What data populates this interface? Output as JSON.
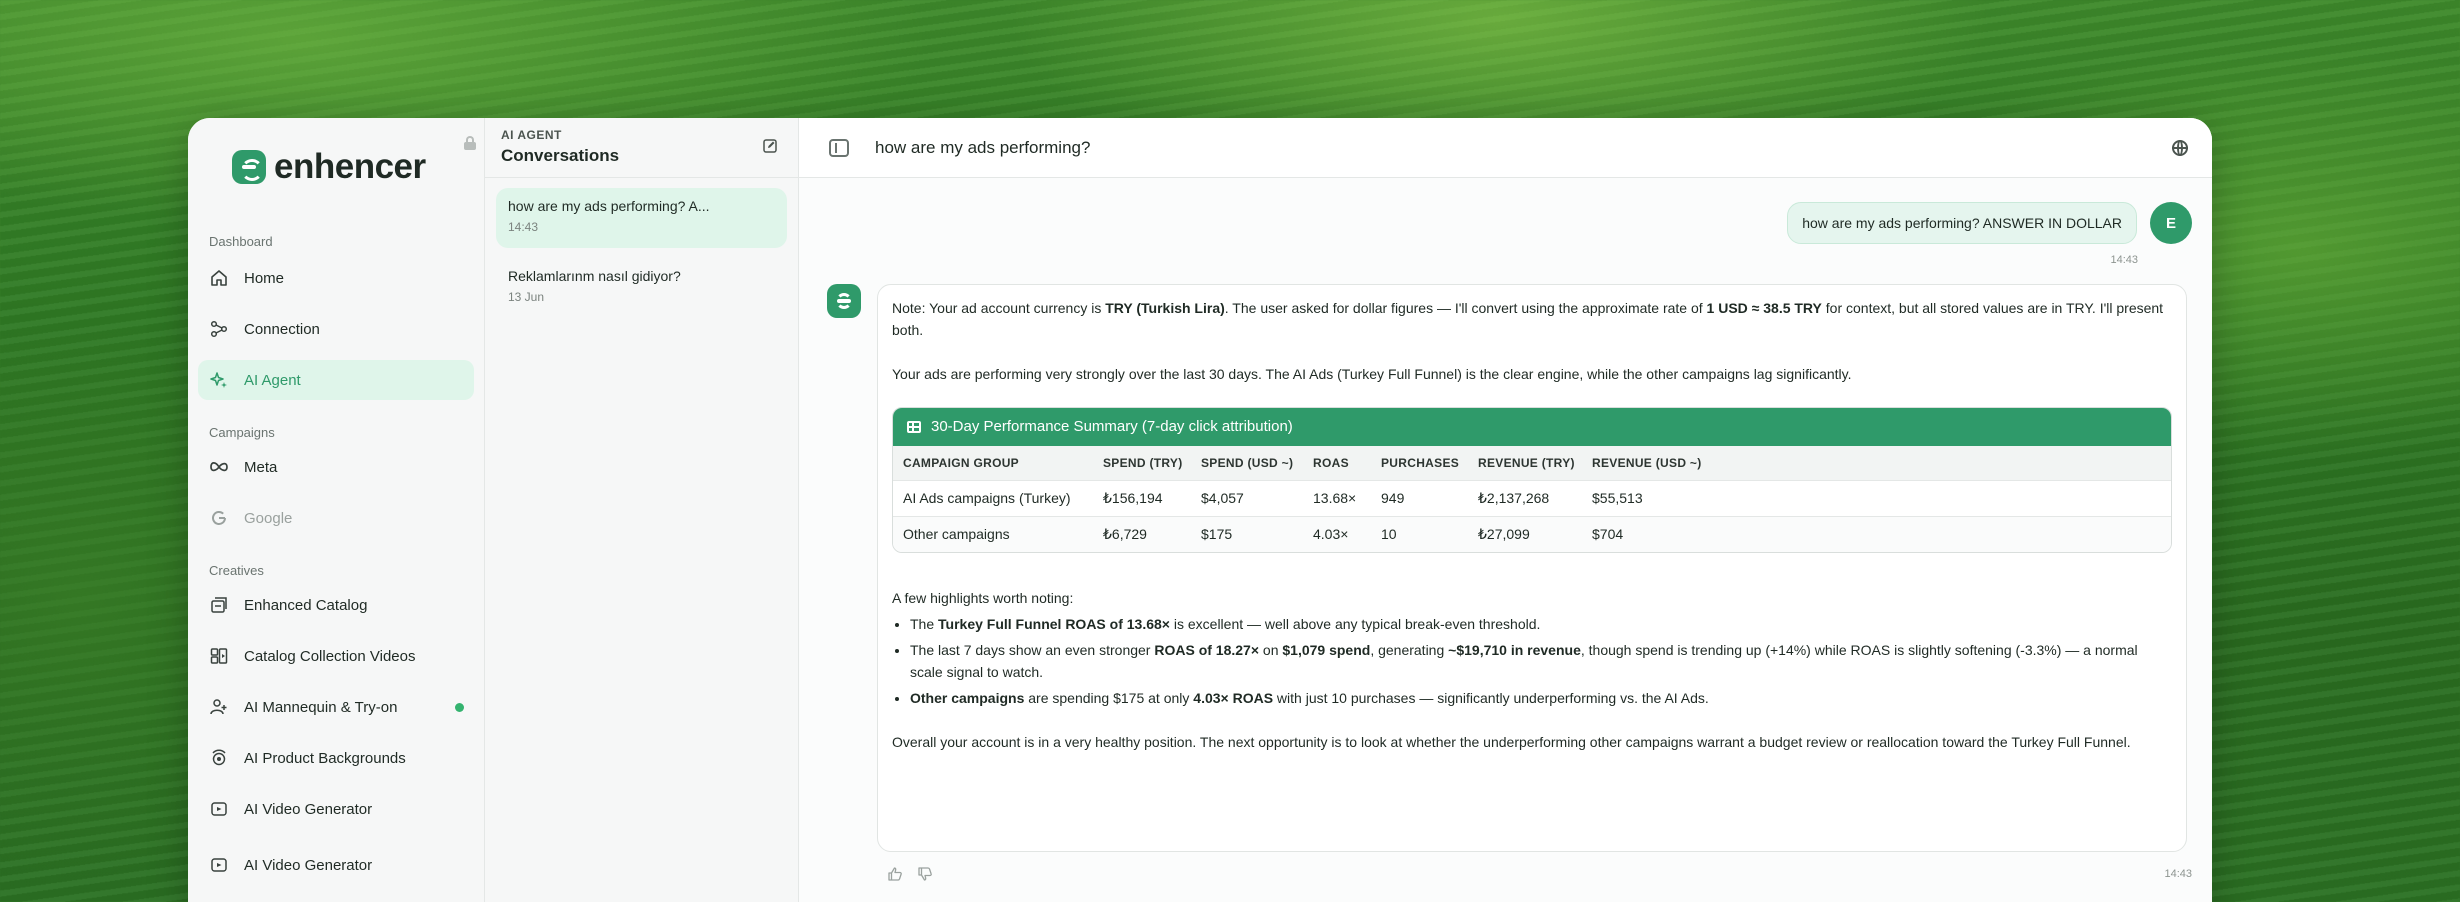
{
  "brand": {
    "name": "enhencer"
  },
  "sidebar": {
    "sections": [
      {
        "label": "Dashboard"
      },
      {
        "label": "Campaigns"
      },
      {
        "label": "Creatives"
      }
    ],
    "items": [
      {
        "label": "Home",
        "icon": "home-icon"
      },
      {
        "label": "Connection",
        "icon": "share-nodes-icon"
      },
      {
        "label": "AI Agent",
        "icon": "sparkle-icon",
        "active": true
      },
      {
        "label": "Meta",
        "icon": "meta-infinity-icon"
      },
      {
        "label": "Google",
        "icon": "google-g-icon",
        "disabled": true
      },
      {
        "label": "Enhanced Catalog",
        "icon": "catalog-icon"
      },
      {
        "label": "Catalog Collection Videos",
        "icon": "collection-icon"
      },
      {
        "label": "AI Mannequin & Try-on",
        "icon": "mannequin-icon",
        "badge_dot": true
      },
      {
        "label": "AI Product Backgrounds",
        "icon": "background-icon"
      },
      {
        "label": "AI Video Generator",
        "icon": "video-icon"
      },
      {
        "label": "AI Video Generator",
        "icon": "video-icon"
      }
    ]
  },
  "conversations": {
    "kicker": "AI AGENT",
    "title": "Conversations",
    "items": [
      {
        "title": "how are my ads performing? A...",
        "time": "14:43",
        "active": true
      },
      {
        "title": "Reklamlarınm nasıl gidiyor?",
        "time": "13 Jun"
      }
    ]
  },
  "chat": {
    "title": "how are my ads performing?",
    "user_message": "how are my ads performing? ANSWER IN DOLLAR",
    "user_avatar": "E",
    "user_time": "14:43",
    "bot_time": "14:43",
    "note": {
      "pre1": "Note: Your ad account currency is ",
      "b1": "TRY (Turkish Lira)",
      "mid": ". The user asked for dollar figures — I'll convert using the approximate rate of ",
      "b2": "1 USD ≈ 38.5 TRY",
      "post": " for context, but all stored values are in TRY. I'll present both."
    },
    "intro": "Your ads are performing very strongly over the last 30 days. The AI Ads (Turkey Full Funnel) is the clear engine, while the other campaigns lag significantly.",
    "table": {
      "title": "30-Day Performance Summary (7-day click attribution)",
      "headers": [
        "CAMPAIGN GROUP",
        "SPEND (TRY)",
        "SPEND (USD ~)",
        "ROAS",
        "PURCHASES",
        "REVENUE (TRY)",
        "REVENUE (USD ~)"
      ],
      "rows": [
        [
          "AI Ads campaigns (Turkey)",
          "₺156,194",
          "$4,057",
          "13.68×",
          "949",
          "₺2,137,268",
          "$55,513"
        ],
        [
          "Other campaigns",
          "₺6,729",
          "$175",
          "4.03×",
          "10",
          "₺27,099",
          "$704"
        ]
      ]
    },
    "highlights_intro": "A few highlights worth noting:",
    "bullets": [
      {
        "a": "The ",
        "b": "Turkey Full Funnel ROAS of 13.68×",
        "c": " is excellent — well above any typical break-even threshold."
      },
      {
        "a": "The last 7 days show an even stronger ",
        "b": "ROAS of 18.27×",
        "c": " on ",
        "d": "$1,079 spend",
        "e": ", generating ",
        "f": "~$19,710 in revenue",
        "g": ", though spend is trending up (+14%) while ROAS is slightly softening (-3.3%) — a normal scale signal to watch."
      },
      {
        "a": "",
        "b": "Other campaigns",
        "c": " are spending $175 at only ",
        "d": "4.03× ROAS",
        "e": " with just 10 purchases — significantly underperforming vs. the AI Ads."
      }
    ],
    "conclusion": "Overall your account is in a very healthy position. The next opportunity is to look at whether the underperforming other campaigns warrant a budget review or reallocation toward the Turkey Full Funnel."
  },
  "colors": {
    "accent": "#2f9a6a",
    "active_bg": "#dff5ea",
    "dot": "#34b36f"
  }
}
